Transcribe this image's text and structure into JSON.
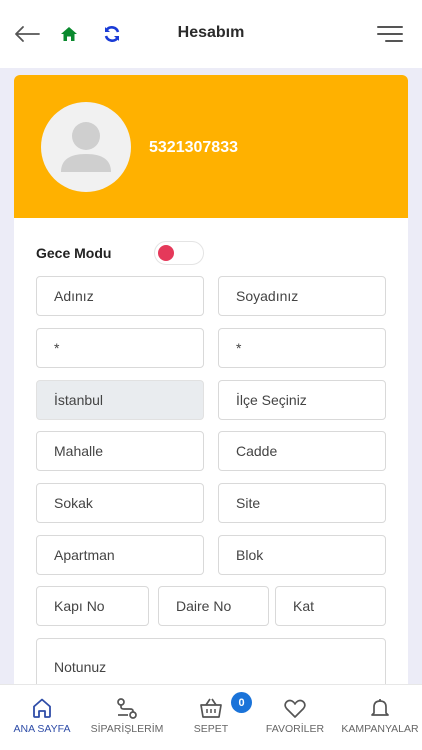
{
  "header": {
    "title": "Hesabım",
    "icons": {
      "back": "arrow-left-icon",
      "home": "home-icon",
      "refresh": "refresh-icon",
      "menu": "menu-icon"
    },
    "colors": {
      "home": "#0a8a2e",
      "refresh": "#1a3bd6"
    }
  },
  "profile": {
    "phone": "5321307833",
    "background": "#ffb100"
  },
  "night_mode": {
    "label": "Gece Modu",
    "enabled": false,
    "knob_color": "#e5395a"
  },
  "form": {
    "first_name": "Adınız",
    "last_name": "Soyadınız",
    "field3": "*",
    "field4": "*",
    "city": "İstanbul",
    "district": "İlçe Seçiniz",
    "neighborhood": "Mahalle",
    "street": "Cadde",
    "lane": "Sokak",
    "site": "Site",
    "building": "Apartman",
    "block": "Blok",
    "door_no": "Kapı No",
    "apartment_no": "Daire No",
    "floor": "Kat",
    "note": "Notunuz"
  },
  "bottom_nav": {
    "items": [
      {
        "label": "ANA SAYFA",
        "icon": "home-icon",
        "active": true
      },
      {
        "label": "SİPARİŞLERİM",
        "icon": "route-icon",
        "active": false
      },
      {
        "label": "SEPET",
        "icon": "basket-icon",
        "active": false
      },
      {
        "label": "FAVORİLER",
        "icon": "heart-icon",
        "active": false
      },
      {
        "label": "KAMPANYALAR",
        "icon": "bell-icon",
        "active": false
      }
    ],
    "cart_count": "0",
    "active_color": "#2f4da8"
  }
}
